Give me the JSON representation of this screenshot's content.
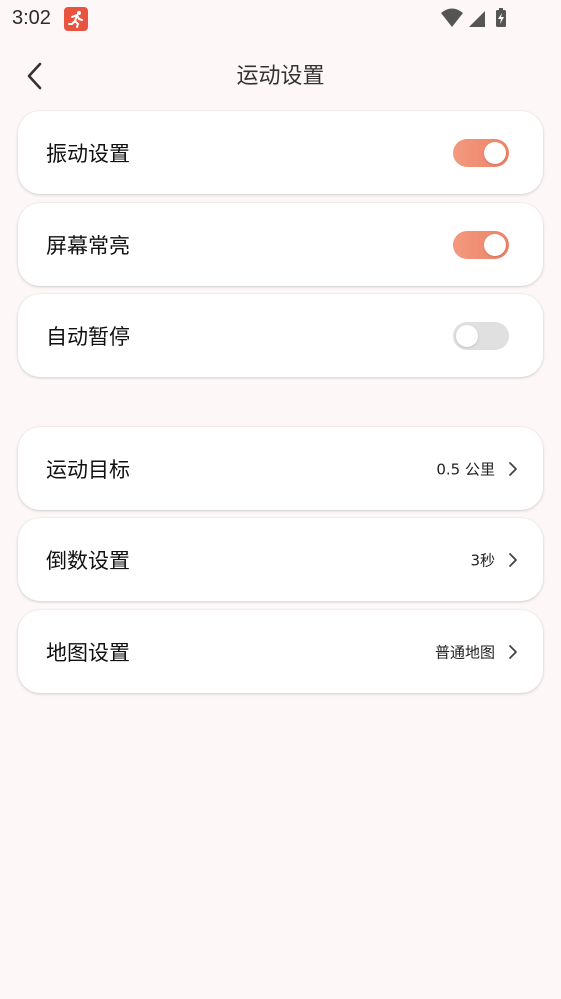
{
  "status_bar": {
    "time": "3:02",
    "app_icon": "running-app-icon",
    "icons": [
      "wifi-icon",
      "cellular-signal-icon",
      "battery-charging-icon"
    ]
  },
  "header": {
    "title": "运动设置",
    "back_icon": "back-arrow-icon"
  },
  "toggle_settings": [
    {
      "label": "振动设置",
      "on": true
    },
    {
      "label": "屏幕常亮",
      "on": true
    },
    {
      "label": "自动暂停",
      "on": false
    }
  ],
  "nav_settings": [
    {
      "label": "运动目标",
      "value": "0.5 公里"
    },
    {
      "label": "倒数设置",
      "value": "3秒"
    },
    {
      "label": "地图设置",
      "value": "普通地图"
    }
  ],
  "colors": {
    "background": "#fdf8f7",
    "accent": "#ee8267",
    "toggle_off": "#e0e0e0",
    "app_badge": "#e8543f"
  }
}
